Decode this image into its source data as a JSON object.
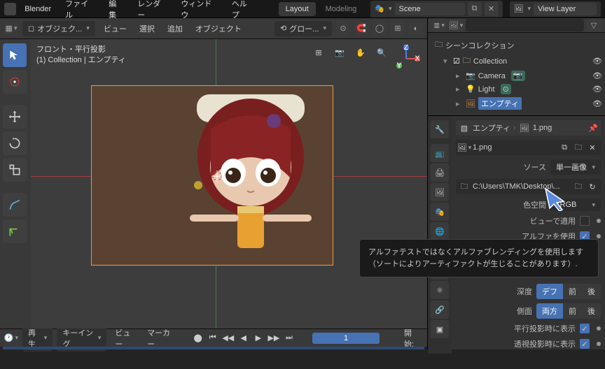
{
  "menu": {
    "app": "Blender",
    "file": "ファイル",
    "edit": "編集",
    "render": "レンダー",
    "window": "ウィンドウ",
    "help": "ヘルプ"
  },
  "tabs": {
    "layout": "Layout",
    "modeling": "Modeling"
  },
  "scene": {
    "label": "Scene",
    "viewlayer": "View Layer"
  },
  "header": {
    "mode": "オブジェク...",
    "view": "ビュー",
    "select": "選択",
    "add": "追加",
    "object": "オブジェクト",
    "orient": "グロー..."
  },
  "overlay": {
    "line1": "フロント・平行投影",
    "line2": "(1) Collection | エンプティ"
  },
  "outliner": {
    "root": "シーンコレクション",
    "collection": "Collection",
    "camera": "Camera",
    "light": "Light",
    "empty": "エンプティ"
  },
  "props": {
    "crumb_empty": "エンプティ",
    "crumb_img": "1.png",
    "img_name": "1.png",
    "source_lbl": "ソース",
    "source_val": "単一画像",
    "path": "C:\\Users\\TMK\\Desktop\\...",
    "colorspace_lbl": "色空間",
    "colorspace_val": "sRGB",
    "viewastexture": "ビューで適用",
    "usealpha": "アルファを使用",
    "depth_lbl": "深度",
    "depth_default": "デフ",
    "front": "前",
    "back": "後",
    "side_lbl": "側面",
    "side_both": "両方",
    "ortho": "平行投影時に表示",
    "persp": "透視投影時に表示"
  },
  "tooltip": {
    "l1": "アルファテストではなくアルファブレンディングを使用します",
    "l2": "（ソートによりアーティファクトが生じることがあります）."
  },
  "timeline": {
    "play": "再生",
    "keying": "キーイング",
    "view": "ビュー",
    "marker": "マーカー",
    "frame": "1",
    "start_lbl": "開始:"
  },
  "search_placeholder": ""
}
